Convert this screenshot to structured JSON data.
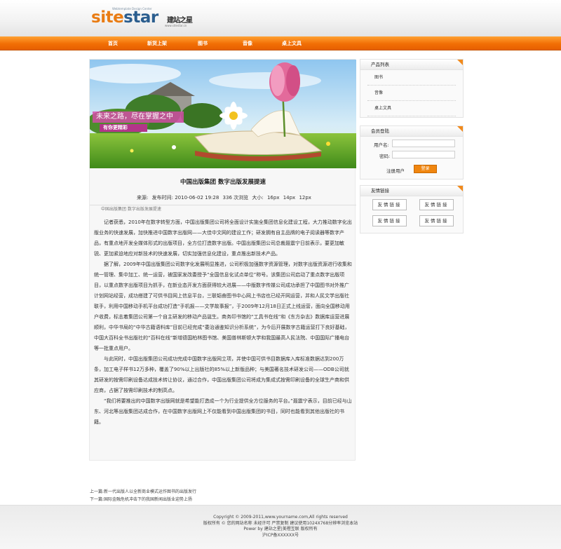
{
  "logo": {
    "main_part1": "site",
    "main_part2": "star",
    "cn": "建站之星",
    "tagline": "Webtemplate Design Center",
    "url": "www.sitestar.cn"
  },
  "nav": [
    "首页",
    "新货上架",
    "图书",
    "音像",
    "桌上文具"
  ],
  "banner": {
    "caption": "未来之路，尽在掌握之中",
    "subcaption": "有你更精彩"
  },
  "article": {
    "title": "中国出版集团 数字出版发展提速",
    "meta": {
      "source_label": "来源:",
      "time": "发布时间: 2010-06-02 19:28",
      "views": "336 次浏览",
      "size_label": "大小:",
      "size_options": [
        "16px",
        "14px",
        "12px"
      ]
    },
    "crumb": "中国出版集团 数字出版发展提速",
    "paragraphs": [
      "记者获悉，2010年在数字转型方面，中国出版集团公司将全面设计实施全集团信息化建设工程，大力推动数字化出版业务的快速发展，加快推进中国数字出版网——大佳中文网的建设工作；研发拥有自主品牌的电子阅读器等数字产品，有重点地开发全媒体形式的出版项目，全方位打造数字出版。中国出版集团公司总裁聂震宁日前表示，要更加敏锐、更加紧迫地应对新技术的快速发展，切实加强信息化建设，重点推出新技术产品。",
      "据了解，2009年中国出版集团公司数字化发展明显推进，公司积极加强数字资源管理，对数字出版资源进行收集和统一管理、集中加工、统一运营，被国家发改委授予“全国信息化试点单位”称号。该集团公司启动了重点数字出版项目，以重点数字出版项目为抓手，在新业态开发方面获得较大进展——中版数字传媒公司成功承担了中国图书对外推广计划网站经营，成功搭建了可供书目网上信息平台，三联韬奋图书中心网上书店也已经开网运营，并和人民文学出版社联手，利用中国移动手机平台成功打造“手机报——文学故事报”，于2009年12月18日正式上线运营，面向全国移动用户收费，标志着集团公司第一个自主研发的移动产品诞生。商务印书馆的“工具书在线”和《东方杂志》数据库运营进展顺利，中华书局的“中华古籍语料库”目前已经完成“委治通鉴知识分析系统”，为今后开展数字古籍运营打下良好基础，中国大百科全书出版社的“百科在线”新增德国柏林图书馆、美国普林斯顿大学和我国最高人民法院、中国国际广播电台等一批重点用户。",
      "与此同时，中国出版集团公司成功完成中国数字出版网立项，并使中国可供书目数据库入库标准数据达到200万条，加工电子样书12万多种，覆盖了90%以上出版社的85%以上新版品种；与美国著名技术研发公司——ODB公司就其研发的按需印刷设备达成技术转让协议，通过合作，中国出版集团公司将成为集成式按需印刷设备的全球生产商和供应商，占据了按需印刷技术的制高点。",
      "“我们将要推出的中国数字出版网就是希望能打造成一个为行业提供全方位服务的平台。”聂震宁表示，目前已经与山东、河北等出版集团达成合作，在中国数字出版网上不仅能看到中国出版集团的书目，同时也能看到其他出版社的书籍。"
    ]
  },
  "sidebar": {
    "products": {
      "title": "产品列表",
      "items": [
        "图书",
        "音像",
        "桌上文具"
      ]
    },
    "login": {
      "title": "会员登陆",
      "username_label": "用户名:",
      "password_label": "密码:",
      "register": "注册用户",
      "login_button": "登录"
    },
    "links": {
      "title": "友情链接",
      "items": [
        "友情链接",
        "友情链接",
        "友情链接",
        "友情链接"
      ]
    }
  },
  "pager": {
    "prev": "上一篇:新一代出版人以全新商业模式运作图书的出版发行",
    "next": "下一篇:国际金融危机冲击下的我国新闻出版业迎势上扬"
  },
  "footer": {
    "copyright": "Copyright © 2009-2011,www.yourname.com,All rights reserved",
    "line2": "版权所有 © 您的网站名称 未经许可 严禁复制 建议使用1024X768分辨率浏览本站",
    "line3": "Power by 建站之星|美橙互联 版权所有",
    "icp": "沪ICP备XXXXXX号"
  }
}
